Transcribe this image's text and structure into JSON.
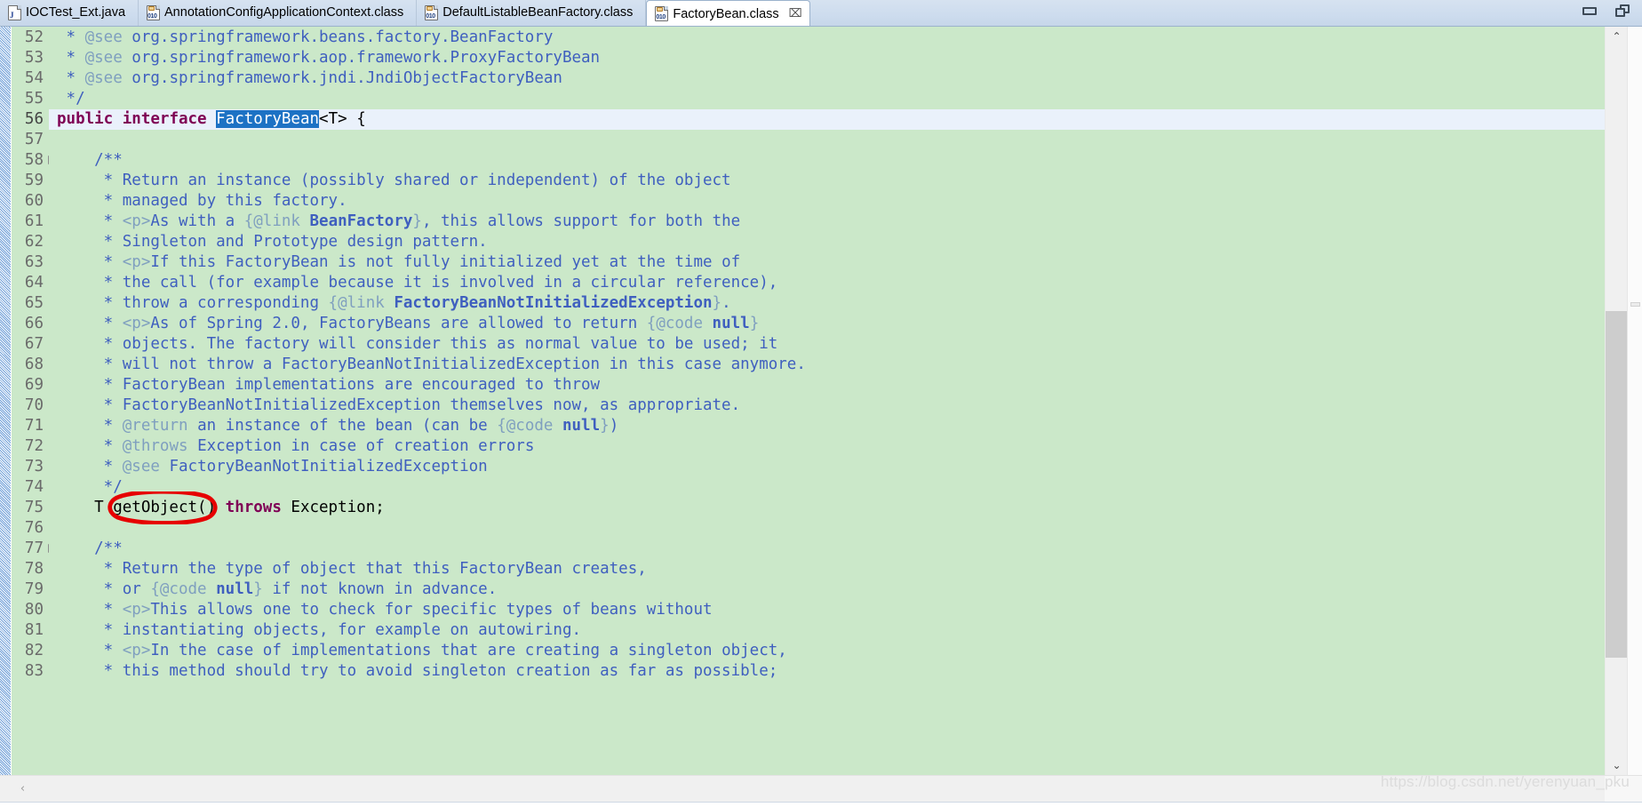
{
  "window": {
    "controls": [
      {
        "name": "minimize",
        "glyph": "minimize-icon"
      },
      {
        "name": "maximize",
        "glyph": "restore-icon"
      }
    ]
  },
  "tabs": [
    {
      "label": "IOCTest_Ext.java",
      "icon": "java-file-icon",
      "active": false,
      "closable": false
    },
    {
      "label": "AnnotationConfigApplicationContext.class",
      "icon": "class-file-icon",
      "active": false,
      "closable": false
    },
    {
      "label": "DefaultListableBeanFactory.class",
      "icon": "class-file-icon",
      "active": false,
      "closable": false
    },
    {
      "label": "FactoryBean.class",
      "icon": "class-file-icon",
      "active": true,
      "closable": true,
      "close_glyph": "⌧"
    }
  ],
  "editor": {
    "language": "java",
    "first_line": 52,
    "current_line": 56,
    "selection_text": "FactoryBean",
    "colors": {
      "comment_background": "#cbe8c9",
      "current_line_background": "#eaf1fb",
      "selection_background": "#1d72c4",
      "javadoc_text": "#3f5fbf",
      "javadoc_tag": "#7f9fbf",
      "keyword": "#7f0055",
      "annotation_red": "#e60000",
      "gutter_background": "#cbe8c9"
    },
    "lines": [
      {
        "n": 52,
        "fold": false,
        "segments": [
          {
            "t": " * ",
            "c": "cmt"
          },
          {
            "t": "@see",
            "c": "cmt-tag"
          },
          {
            "t": " org.springframework.beans.factory.BeanFactory",
            "c": "cmt"
          }
        ]
      },
      {
        "n": 53,
        "fold": false,
        "segments": [
          {
            "t": " * ",
            "c": "cmt"
          },
          {
            "t": "@see",
            "c": "cmt-tag"
          },
          {
            "t": " org.springframework.aop.framework.ProxyFactoryBean",
            "c": "cmt"
          }
        ]
      },
      {
        "n": 54,
        "fold": false,
        "segments": [
          {
            "t": " * ",
            "c": "cmt"
          },
          {
            "t": "@see",
            "c": "cmt-tag"
          },
          {
            "t": " org.springframework.jndi.JndiObjectFactoryBean",
            "c": "cmt"
          }
        ]
      },
      {
        "n": 55,
        "fold": false,
        "segments": [
          {
            "t": " */",
            "c": "cmt"
          }
        ]
      },
      {
        "n": 56,
        "fold": false,
        "current": true,
        "segments": [
          {
            "t": "public",
            "c": "kw"
          },
          {
            "t": " ",
            "c": "plain"
          },
          {
            "t": "interface",
            "c": "kw"
          },
          {
            "t": " ",
            "c": "plain"
          },
          {
            "t": "FactoryBean",
            "c": "sel"
          },
          {
            "t": "<T> {",
            "c": "plain"
          }
        ]
      },
      {
        "n": 57,
        "fold": false,
        "segments": [
          {
            "t": "",
            "c": "plain"
          }
        ]
      },
      {
        "n": 58,
        "fold": true,
        "segments": [
          {
            "t": "    /**",
            "c": "cmt"
          }
        ]
      },
      {
        "n": 59,
        "fold": false,
        "segments": [
          {
            "t": "     * Return an instance (possibly shared or independent) of the object",
            "c": "cmt"
          }
        ]
      },
      {
        "n": 60,
        "fold": false,
        "segments": [
          {
            "t": "     * managed by this factory.",
            "c": "cmt"
          }
        ]
      },
      {
        "n": 61,
        "fold": false,
        "segments": [
          {
            "t": "     * ",
            "c": "cmt"
          },
          {
            "t": "<p>",
            "c": "cmt-html"
          },
          {
            "t": "As with a ",
            "c": "cmt"
          },
          {
            "t": "{@link",
            "c": "cmt-tag"
          },
          {
            "t": " ",
            "c": "cmt"
          },
          {
            "t": "BeanFactory",
            "c": "cmt-link"
          },
          {
            "t": "}",
            "c": "cmt-tag"
          },
          {
            "t": ", this allows support for both the",
            "c": "cmt"
          }
        ]
      },
      {
        "n": 62,
        "fold": false,
        "segments": [
          {
            "t": "     * Singleton and Prototype design pattern.",
            "c": "cmt"
          }
        ]
      },
      {
        "n": 63,
        "fold": false,
        "segments": [
          {
            "t": "     * ",
            "c": "cmt"
          },
          {
            "t": "<p>",
            "c": "cmt-html"
          },
          {
            "t": "If this FactoryBean is not fully initialized yet at the time of",
            "c": "cmt"
          }
        ]
      },
      {
        "n": 64,
        "fold": false,
        "segments": [
          {
            "t": "     * the call (for example because it is involved in a circular reference),",
            "c": "cmt"
          }
        ]
      },
      {
        "n": 65,
        "fold": false,
        "segments": [
          {
            "t": "     * throw a corresponding ",
            "c": "cmt"
          },
          {
            "t": "{@link",
            "c": "cmt-tag"
          },
          {
            "t": " ",
            "c": "cmt"
          },
          {
            "t": "FactoryBeanNotInitializedException",
            "c": "cmt-link"
          },
          {
            "t": "}",
            "c": "cmt-tag"
          },
          {
            "t": ".",
            "c": "cmt"
          }
        ]
      },
      {
        "n": 66,
        "fold": false,
        "segments": [
          {
            "t": "     * ",
            "c": "cmt"
          },
          {
            "t": "<p>",
            "c": "cmt-html"
          },
          {
            "t": "As of Spring 2.0, FactoryBeans are allowed to return ",
            "c": "cmt"
          },
          {
            "t": "{@code",
            "c": "cmt-tag"
          },
          {
            "t": " ",
            "c": "cmt"
          },
          {
            "t": "null",
            "c": "cmt-link"
          },
          {
            "t": "}",
            "c": "cmt-tag"
          }
        ]
      },
      {
        "n": 67,
        "fold": false,
        "segments": [
          {
            "t": "     * objects. The factory will consider this as normal value to be used; it",
            "c": "cmt"
          }
        ]
      },
      {
        "n": 68,
        "fold": false,
        "segments": [
          {
            "t": "     * will not throw a FactoryBeanNotInitializedException in this case anymore.",
            "c": "cmt"
          }
        ]
      },
      {
        "n": 69,
        "fold": false,
        "segments": [
          {
            "t": "     * FactoryBean implementations are encouraged to throw",
            "c": "cmt"
          }
        ]
      },
      {
        "n": 70,
        "fold": false,
        "segments": [
          {
            "t": "     * FactoryBeanNotInitializedException themselves now, as appropriate.",
            "c": "cmt"
          }
        ]
      },
      {
        "n": 71,
        "fold": false,
        "segments": [
          {
            "t": "     * ",
            "c": "cmt"
          },
          {
            "t": "@return",
            "c": "cmt-tag"
          },
          {
            "t": " an instance of the bean (can be ",
            "c": "cmt"
          },
          {
            "t": "{@code",
            "c": "cmt-tag"
          },
          {
            "t": " ",
            "c": "cmt"
          },
          {
            "t": "null",
            "c": "cmt-link"
          },
          {
            "t": "}",
            "c": "cmt-tag"
          },
          {
            "t": ")",
            "c": "cmt"
          }
        ]
      },
      {
        "n": 72,
        "fold": false,
        "segments": [
          {
            "t": "     * ",
            "c": "cmt"
          },
          {
            "t": "@throws",
            "c": "cmt-tag"
          },
          {
            "t": " Exception in case of creation errors",
            "c": "cmt"
          }
        ]
      },
      {
        "n": 73,
        "fold": false,
        "segments": [
          {
            "t": "     * ",
            "c": "cmt"
          },
          {
            "t": "@see",
            "c": "cmt-tag"
          },
          {
            "t": " FactoryBeanNotInitializedException",
            "c": "cmt"
          }
        ]
      },
      {
        "n": 74,
        "fold": false,
        "segments": [
          {
            "t": "     */",
            "c": "cmt"
          }
        ]
      },
      {
        "n": 75,
        "fold": false,
        "segments": [
          {
            "t": "    T getObject() ",
            "c": "plain"
          },
          {
            "t": "throws",
            "c": "kw"
          },
          {
            "t": " Exception;",
            "c": "plain"
          }
        ]
      },
      {
        "n": 76,
        "fold": false,
        "segments": [
          {
            "t": "",
            "c": "plain"
          }
        ]
      },
      {
        "n": 77,
        "fold": true,
        "segments": [
          {
            "t": "    /**",
            "c": "cmt"
          }
        ]
      },
      {
        "n": 78,
        "fold": false,
        "segments": [
          {
            "t": "     * Return the type of object that this FactoryBean creates,",
            "c": "cmt"
          }
        ]
      },
      {
        "n": 79,
        "fold": false,
        "segments": [
          {
            "t": "     * or ",
            "c": "cmt"
          },
          {
            "t": "{@code",
            "c": "cmt-tag"
          },
          {
            "t": " ",
            "c": "cmt"
          },
          {
            "t": "null",
            "c": "cmt-link"
          },
          {
            "t": "}",
            "c": "cmt-tag"
          },
          {
            "t": " if not known in advance.",
            "c": "cmt"
          }
        ]
      },
      {
        "n": 80,
        "fold": false,
        "segments": [
          {
            "t": "     * ",
            "c": "cmt"
          },
          {
            "t": "<p>",
            "c": "cmt-html"
          },
          {
            "t": "This allows one to check for specific types of beans without",
            "c": "cmt"
          }
        ]
      },
      {
        "n": 81,
        "fold": false,
        "segments": [
          {
            "t": "     * instantiating objects, for example on autowiring.",
            "c": "cmt"
          }
        ]
      },
      {
        "n": 82,
        "fold": false,
        "segments": [
          {
            "t": "     * ",
            "c": "cmt"
          },
          {
            "t": "<p>",
            "c": "cmt-html"
          },
          {
            "t": "In the case of implementations that are creating a singleton object,",
            "c": "cmt"
          }
        ]
      },
      {
        "n": 83,
        "fold": false,
        "segments": [
          {
            "t": "     * this method should try to avoid singleton creation as far as possible;",
            "c": "cmt"
          }
        ]
      }
    ]
  },
  "annotation": {
    "kind": "red-ellipse",
    "target_text": "getObject()",
    "color": "#e60000"
  },
  "scrollbars": {
    "vertical": {
      "up_glyph": "⌃",
      "down_glyph": "⌄"
    },
    "horizontal": {
      "left_glyph": "‹",
      "right_glyph": "›"
    }
  },
  "watermark": {
    "text": "https://blog.csdn.net/yerenyuan_pku"
  }
}
